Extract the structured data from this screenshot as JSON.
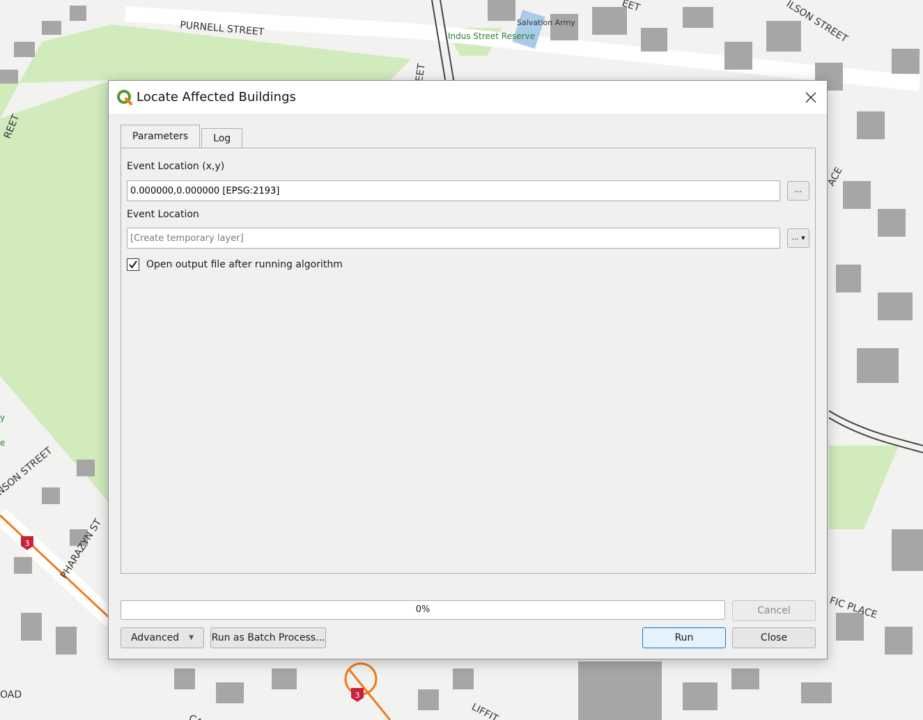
{
  "map": {
    "street_labels": [
      "PURNELL STREET",
      "EET",
      "EET",
      "REET",
      "ILSON STREET",
      "ACE",
      "NSON STREET",
      "PHARAZYN ST",
      "FIC PLACE",
      "OAD",
      "LIFFIT",
      "CA"
    ],
    "poi_labels": [
      "Indus Street Reserve",
      "Salvation Army"
    ],
    "route_shield": "3",
    "edge_fragments": [
      "y",
      "e"
    ]
  },
  "dialog": {
    "title": "Locate Affected Buildings",
    "icon": "qgis-logo-icon",
    "tabs": [
      {
        "label": "Parameters",
        "active": true
      },
      {
        "label": "Log",
        "active": false
      }
    ],
    "params": {
      "event_location_xy_label": "Event Location (x,y)",
      "event_location_xy_value": "0.000000,0.000000 [EPSG:2193]",
      "event_location_label": "Event Location",
      "event_location_placeholder": "[Create temporary layer]",
      "browse_label": "...",
      "output_browse_label": "...",
      "open_output_checked": true,
      "open_output_label": "Open output file after running algorithm"
    },
    "progress": {
      "value": 0,
      "text": "0%"
    },
    "buttons": {
      "cancel": "Cancel",
      "advanced": "Advanced",
      "batch": "Run as Batch Process...",
      "run": "Run",
      "close": "Close"
    }
  }
}
